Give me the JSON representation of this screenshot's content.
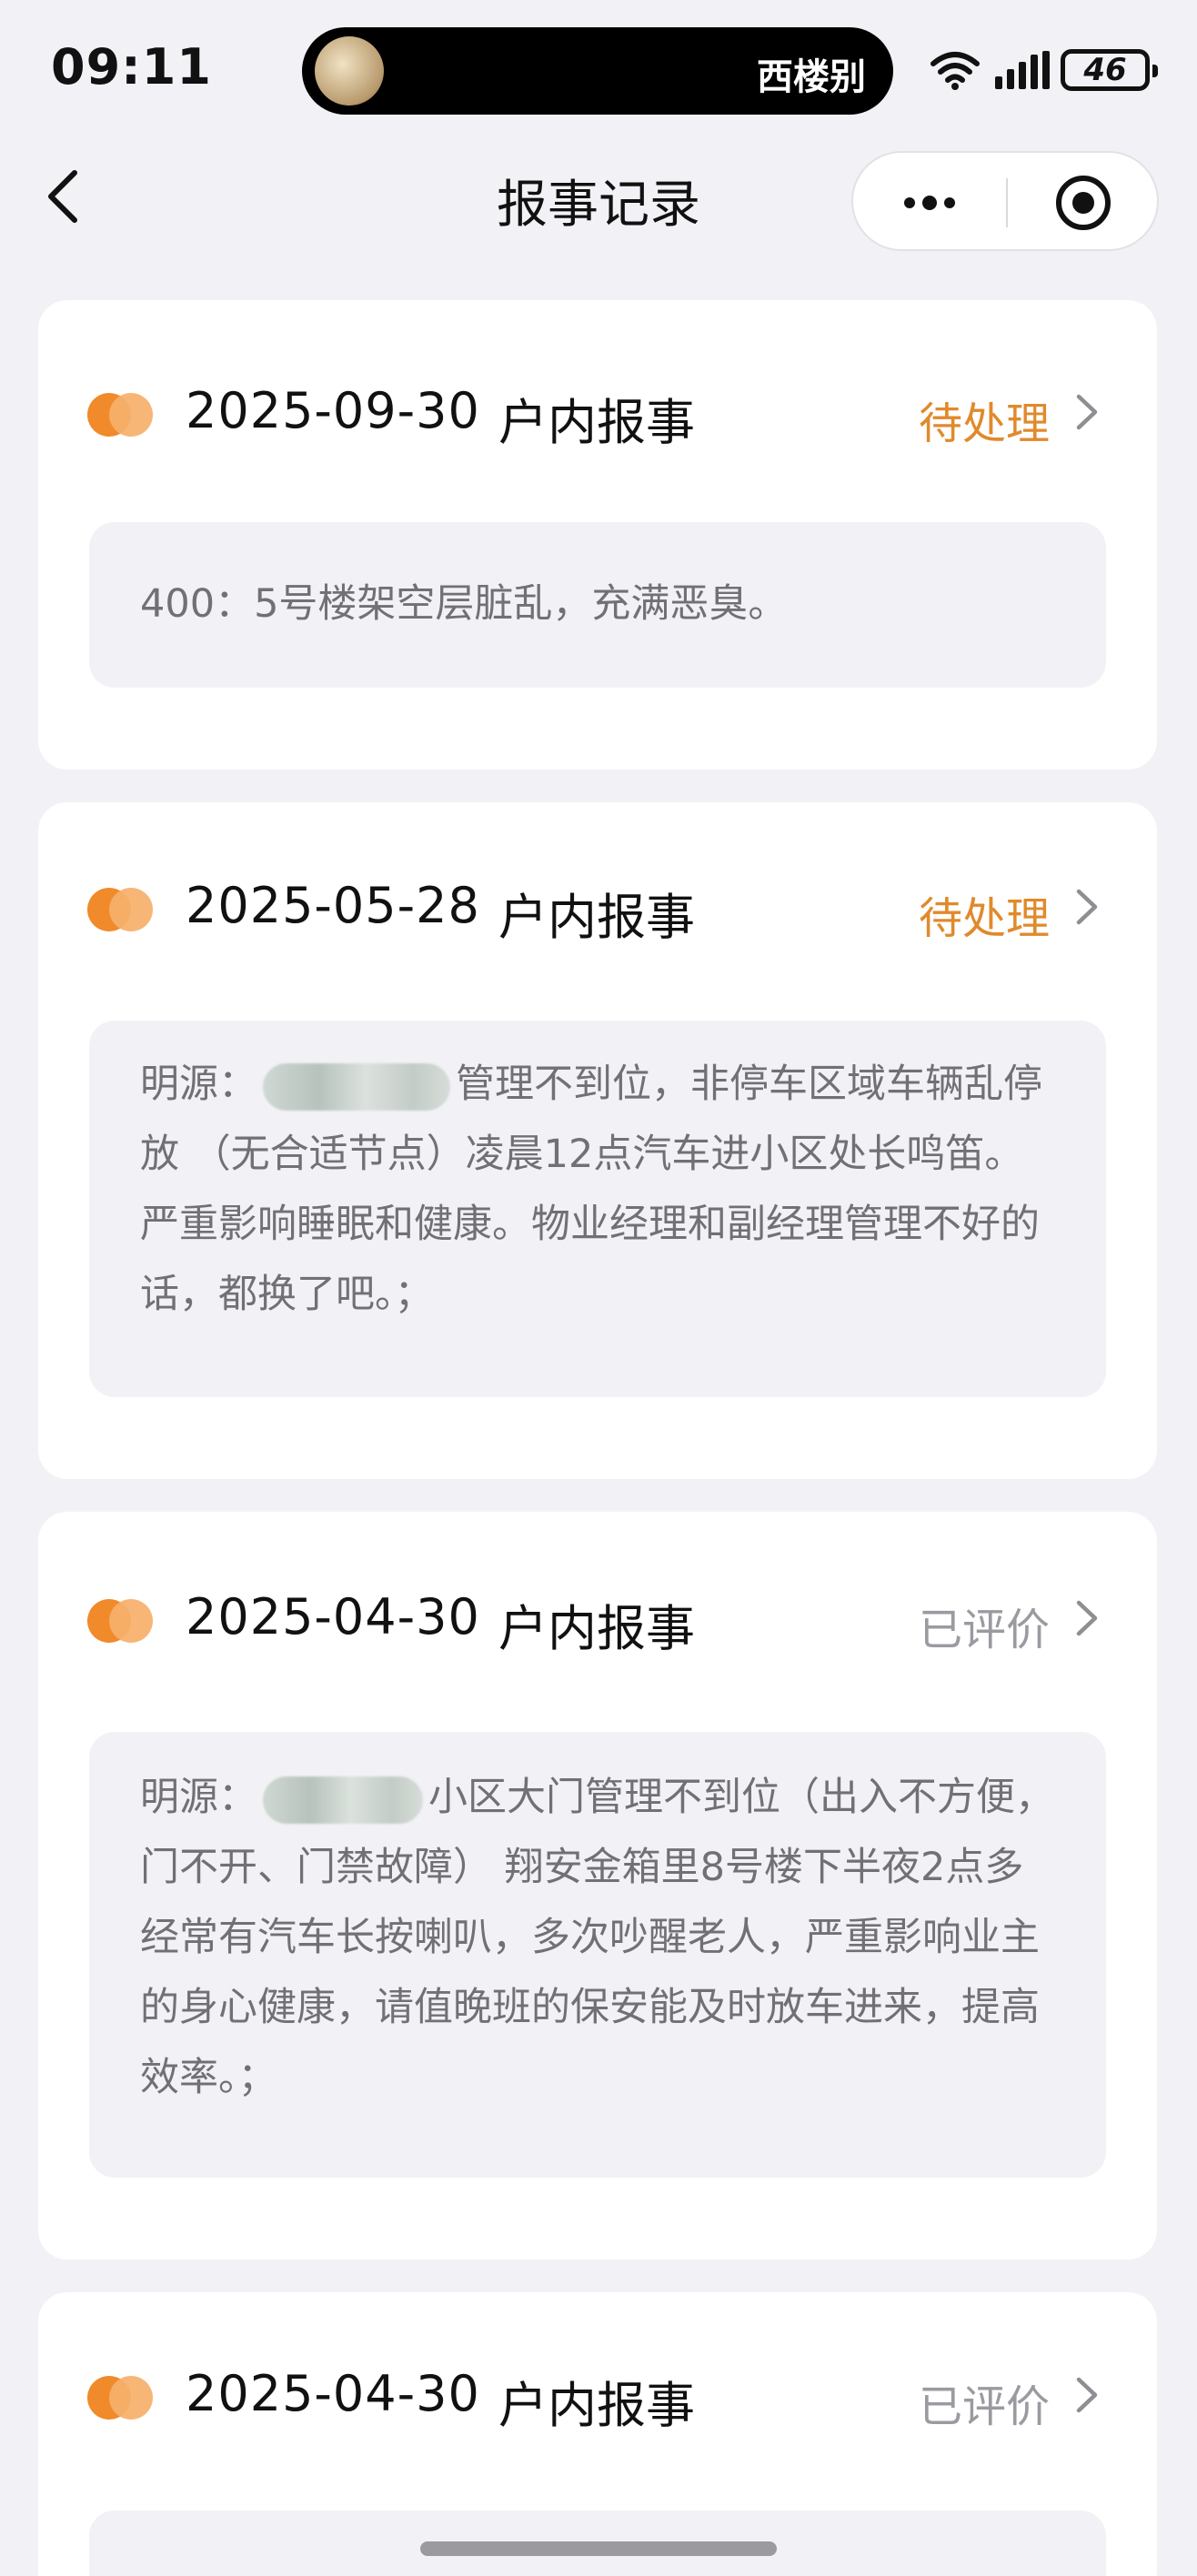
{
  "status_bar": {
    "time": "09:11",
    "now_playing": "西楼别",
    "battery": "46"
  },
  "nav": {
    "title": "报事记录"
  },
  "records": [
    {
      "date": "2025-09-30",
      "type": "户内报事",
      "status": "待处理",
      "status_kind": "pending",
      "description": "400：5号楼架空层脏乱，充满恶臭。"
    },
    {
      "date": "2025-05-28",
      "type": "户内报事",
      "status": "待处理",
      "status_kind": "pending",
      "description_prefix": "明源：",
      "description_suffix": "管理不到位，非停车区域车辆乱停放 （无合适节点）凌晨12点汽车进小区处长鸣笛。严重影响睡眠和健康。物业经理和副经理管理不好的话，都换了吧。；"
    },
    {
      "date": "2025-04-30",
      "type": "户内报事",
      "status": "已评价",
      "status_kind": "rated",
      "description_prefix": "明源：",
      "description_suffix": "小区大门管理不到位（出入不方便，门不开、门禁故障） 翔安金箱里8号楼下半夜2点多经常有汽车长按喇叭，多次吵醒老人，严重影响业主的身心健康，请值晚班的保安能及时放车进来，提高效率。；"
    },
    {
      "date": "2025-04-30",
      "type": "户内报事",
      "status": "已评价",
      "status_kind": "rated"
    }
  ],
  "colors": {
    "pending": "#e08a2c",
    "rated": "#9a9aa0",
    "accent_dot": "#f08a2a"
  }
}
